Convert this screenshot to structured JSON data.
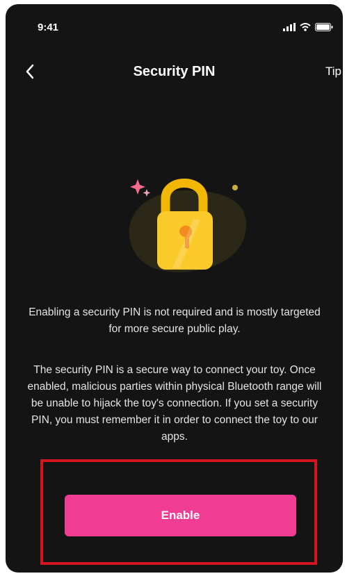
{
  "status_bar": {
    "time": "9:41",
    "icons": [
      "signal-icon",
      "wifi-icon",
      "battery-icon"
    ]
  },
  "nav": {
    "back_icon": "chevron-left-icon",
    "title": "Security PIN",
    "tip_label": "Tip"
  },
  "illustration": {
    "icon": "padlock-icon",
    "colors": {
      "lock_body": "#F7C21B",
      "lock_shackle": "#F2B705",
      "keyhole": "#F28C1E",
      "blob": "#2E2A17",
      "sparkle": "#F56B8C",
      "dot": "#C8B23C"
    }
  },
  "content": {
    "paragraph1": "Enabling a security PIN is not required and is mostly targeted for more secure public play.",
    "paragraph2": "The security PIN is a secure way to connect your toy. Once enabled, malicious parties within physical Bluetooth range will be unable to hijack the toy's connection. If you set a security PIN, you must remember it in order to connect the toy to our apps."
  },
  "actions": {
    "enable_label": "Enable"
  },
  "colors": {
    "background": "#141414",
    "accent": "#F03C93",
    "highlight_border": "#D4141E",
    "text": "#E4E4E4"
  }
}
